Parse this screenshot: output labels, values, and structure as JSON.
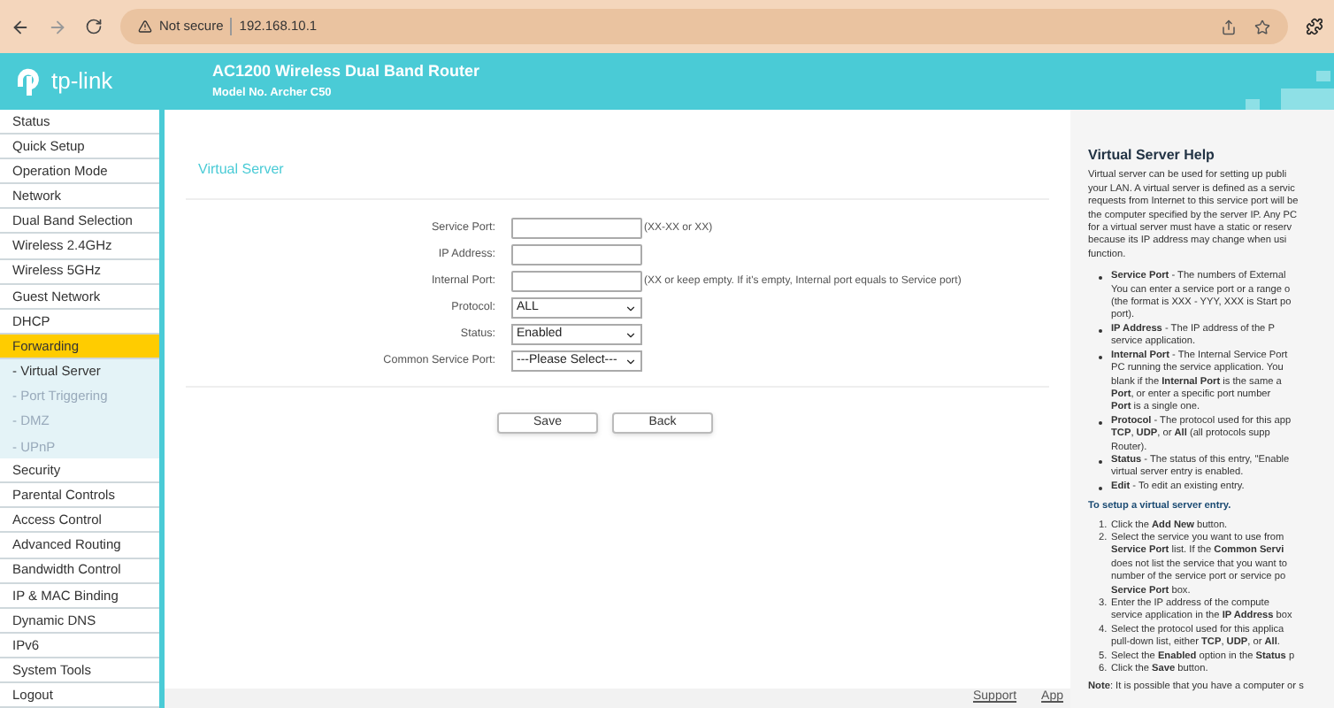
{
  "browser": {
    "security": "Not secure",
    "url": "192.168.10.1"
  },
  "header": {
    "logo_text": "tp-link",
    "title": "AC1200 Wireless Dual Band Router",
    "model": "Model No. Archer C50"
  },
  "sidebar": {
    "items": [
      {
        "label": "Status",
        "kind": "main",
        "selected": false
      },
      {
        "label": "Quick Setup",
        "kind": "main",
        "selected": false
      },
      {
        "label": "Operation Mode",
        "kind": "main",
        "selected": false
      },
      {
        "label": "Network",
        "kind": "main",
        "selected": false
      },
      {
        "label": "Dual Band Selection",
        "kind": "main",
        "selected": false
      },
      {
        "label": "Wireless 2.4GHz",
        "kind": "main",
        "selected": false
      },
      {
        "label": "Wireless 5GHz",
        "kind": "main",
        "selected": false
      },
      {
        "label": "Guest Network",
        "kind": "main",
        "selected": false
      },
      {
        "label": "DHCP",
        "kind": "main",
        "selected": false
      },
      {
        "label": "Forwarding",
        "kind": "main",
        "selected": true
      },
      {
        "label": "- Virtual Server",
        "kind": "sub",
        "selected": true
      },
      {
        "label": "- Port Triggering",
        "kind": "sub",
        "selected": false
      },
      {
        "label": "- DMZ",
        "kind": "sub",
        "selected": false
      },
      {
        "label": "- UPnP",
        "kind": "sub",
        "selected": false
      },
      {
        "label": "Security",
        "kind": "main",
        "selected": false
      },
      {
        "label": "Parental Controls",
        "kind": "main",
        "selected": false
      },
      {
        "label": "Access Control",
        "kind": "main",
        "selected": false
      },
      {
        "label": "Advanced Routing",
        "kind": "main",
        "selected": false
      },
      {
        "label": "Bandwidth Control",
        "kind": "main",
        "selected": false
      },
      {
        "label": "IP & MAC Binding",
        "kind": "main",
        "selected": false
      },
      {
        "label": "Dynamic DNS",
        "kind": "main",
        "selected": false
      },
      {
        "label": "IPv6",
        "kind": "main",
        "selected": false
      },
      {
        "label": "System Tools",
        "kind": "main",
        "selected": false
      },
      {
        "label": "Logout",
        "kind": "main",
        "selected": false
      }
    ]
  },
  "main": {
    "title": "Virtual Server",
    "fields": [
      {
        "label": "Service Port:",
        "kind": "input",
        "hint": "(XX-XX or XX)"
      },
      {
        "label": "IP Address:",
        "kind": "input"
      },
      {
        "label": "Internal Port:",
        "kind": "input",
        "hint": "(XX or keep empty. If it's empty, Internal port equals to Service port)"
      },
      {
        "label": "Protocol:",
        "kind": "select",
        "value": "ALL"
      },
      {
        "label": "Status:",
        "kind": "select",
        "value": "Enabled"
      },
      {
        "label": "Common Service Port:",
        "kind": "select",
        "value": "---Please Select---"
      }
    ],
    "buttons": [
      "Save",
      "Back"
    ]
  },
  "footer": {
    "links": [
      "Support",
      "App"
    ]
  },
  "help": {
    "title": "Virtual Server Help",
    "intro": [
      "Virtual server can be used for setting up publi",
      "your LAN. A virtual server is defined as a servic",
      "requests from Internet to this service port will be",
      "the computer specified by the server IP. Any PC",
      "for a virtual server must have a static or reserv",
      "because its IP address may change when usi",
      "function."
    ],
    "bullets": [
      [
        "**Service Port** - The numbers of External",
        "You can enter a service port or a range o",
        "(the format is XXX - YYY, XXX is Start po",
        "port)."
      ],
      [
        "**IP Address** - The IP address of the P",
        "service application."
      ],
      [
        "**Internal Port** - The Internal Service Port",
        "PC running the service application. You",
        "blank if the **Internal Port** is the same a",
        "**Port**, or enter a specific port number",
        "**Port** is a single one."
      ],
      [
        "**Protocol** - The protocol used for this app",
        "**TCP**, **UDP**, or **All** (all protocols supp",
        "Router)."
      ],
      [
        "**Status** - The status of this entry, \"Enable",
        "virtual server entry is enabled."
      ],
      [
        "**Edit** - To edit an existing entry."
      ]
    ],
    "setup_heading": "To setup a virtual server entry.",
    "steps": [
      {
        "number": "1.",
        "lines": [
          "Click the **Add New** button."
        ]
      },
      {
        "number": "2.",
        "lines": [
          "Select the service you want to use from",
          "**Service Port** list. If the **Common Servi**",
          "does not list the service that you want to",
          "number of the service port or service po",
          "**Service Port** box."
        ]
      },
      {
        "number": "3.",
        "lines": [
          "Enter the IP address of the compute",
          "service application in the **IP Address** box"
        ]
      },
      {
        "number": "4.",
        "lines": [
          "Select the protocol used for this applica",
          "pull-down list, either **TCP**, **UDP**, or **All**."
        ]
      },
      {
        "number": "5.",
        "lines": [
          "Select the **Enabled** option in the **Status** p"
        ]
      },
      {
        "number": "6.",
        "lines": [
          "Click the **Save** button."
        ]
      }
    ],
    "note": "**Note**: It is possible that you have a computer or s"
  }
}
